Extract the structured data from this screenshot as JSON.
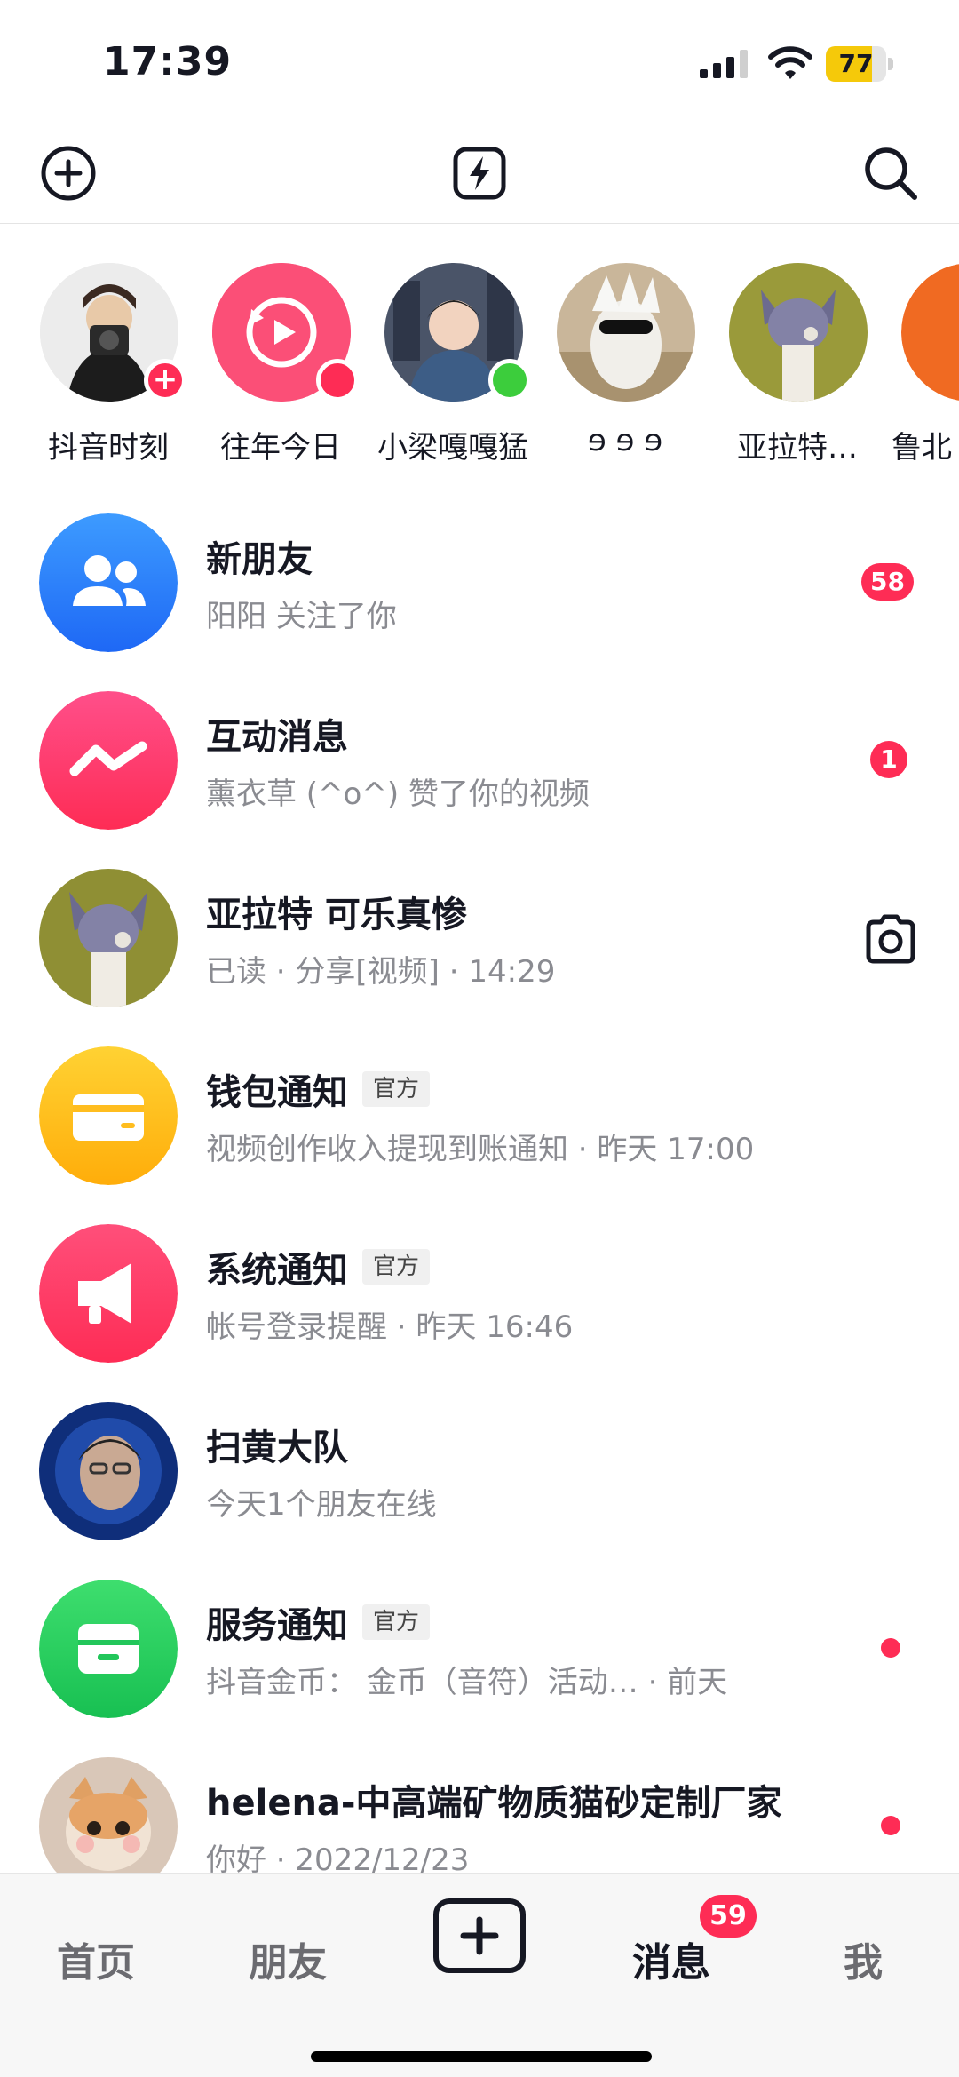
{
  "status_bar": {
    "time": "17:39",
    "battery": "77",
    "battery_level": 0.77
  },
  "toolbar": {
    "add_icon": "plus-circle-icon",
    "flash_icon": "flash-icon",
    "search_icon": "search-icon"
  },
  "stories": [
    {
      "label": "抖音时刻",
      "badge": "plus"
    },
    {
      "label": "往年今日",
      "badge": "red"
    },
    {
      "label": "小梁嘎嘎猛",
      "badge": "green"
    },
    {
      "label": "ɘ ɘ ɘ",
      "badge": "none"
    },
    {
      "label": "亚拉特…",
      "badge": "none"
    },
    {
      "label": "鲁北",
      "badge": "none"
    }
  ],
  "messages": [
    {
      "title": "新朋友",
      "subtitle": "阳阳 关注了你",
      "badge": "58"
    },
    {
      "title": "互动消息",
      "subtitle": "薰衣草 (^o^) 赞了你的视频",
      "badge": "1"
    },
    {
      "title": "亚拉特 可乐真惨",
      "subtitle": "已读 · 分享[视频] · 14:29"
    },
    {
      "title": "钱包通知",
      "tag": "官方",
      "subtitle": "视频创作收入提现到账通知 · 昨天 17:00"
    },
    {
      "title": "系统通知",
      "tag": "官方",
      "subtitle": "帐号登录提醒 · 昨天 16:46"
    },
    {
      "title": "扫黄大队",
      "subtitle": "今天1个朋友在线"
    },
    {
      "title": "服务通知",
      "tag": "官方",
      "subtitle": "抖音金币： 金币（音符）活动… · 前天"
    },
    {
      "title": "helena-中高端矿物质猫砂定制厂家",
      "subtitle": "你好 · 2022/12/23"
    }
  ],
  "bottom_nav": {
    "home": "首页",
    "friends": "朋友",
    "messages": "消息",
    "messages_badge": "59",
    "me": "我"
  },
  "colors": {
    "accent": "#fe2c55",
    "online": "#3ccd3c",
    "battery": "#f5c90a"
  }
}
